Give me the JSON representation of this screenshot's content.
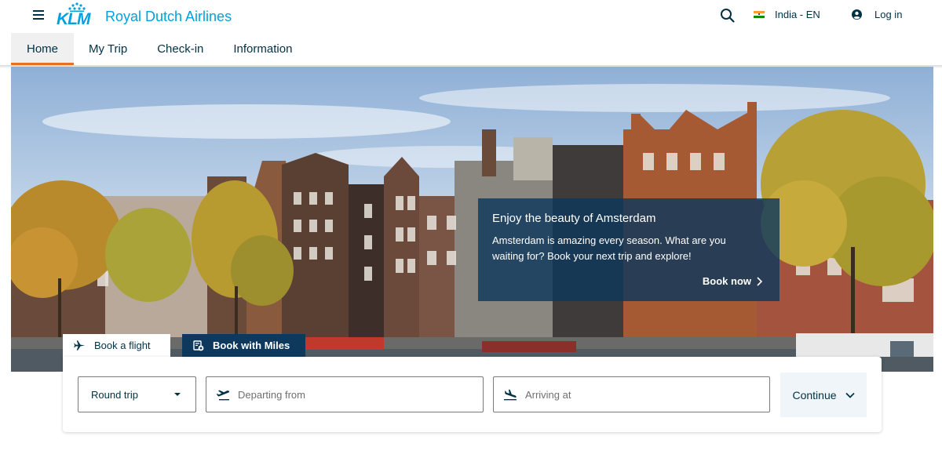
{
  "header": {
    "brand_name": "Royal Dutch Airlines",
    "logo_text": "KLM",
    "locale_label": "India - EN",
    "login_label": "Log in"
  },
  "nav": {
    "tabs": [
      {
        "label": "Home",
        "active": true
      },
      {
        "label": "My Trip",
        "active": false
      },
      {
        "label": "Check-in",
        "active": false
      },
      {
        "label": "Information",
        "active": false
      }
    ]
  },
  "promo": {
    "title": "Enjoy the beauty of Amsterdam",
    "body": "Amsterdam is amazing every season. What are you waiting for? Book your next trip and explore!",
    "link_label": "Book now"
  },
  "booking": {
    "tabs": [
      {
        "label": "Book a flight",
        "active": true
      },
      {
        "label": "Book with Miles",
        "active": false
      }
    ],
    "trip_type": "Round trip",
    "from_placeholder": "Departing from",
    "to_placeholder": "Arriving at",
    "continue_label": "Continue"
  },
  "icons": {
    "menu": "hamburger-menu-icon",
    "search": "search-icon",
    "flag": "india-flag-icon",
    "account": "account-circle-icon",
    "chevron_right": "chevron-right-icon",
    "plane": "plane-icon",
    "miles": "miles-card-icon",
    "takeoff": "plane-takeoff-icon",
    "landing": "plane-landing-icon",
    "chevron_down": "chevron-down-icon",
    "caret": "caret-down-icon"
  },
  "colors": {
    "brand_blue": "#00a1de",
    "navy": "#003145",
    "promo_bg": "#0e385c",
    "active_tab_accent": "#e37222",
    "continue_bg": "#eff5f8"
  }
}
